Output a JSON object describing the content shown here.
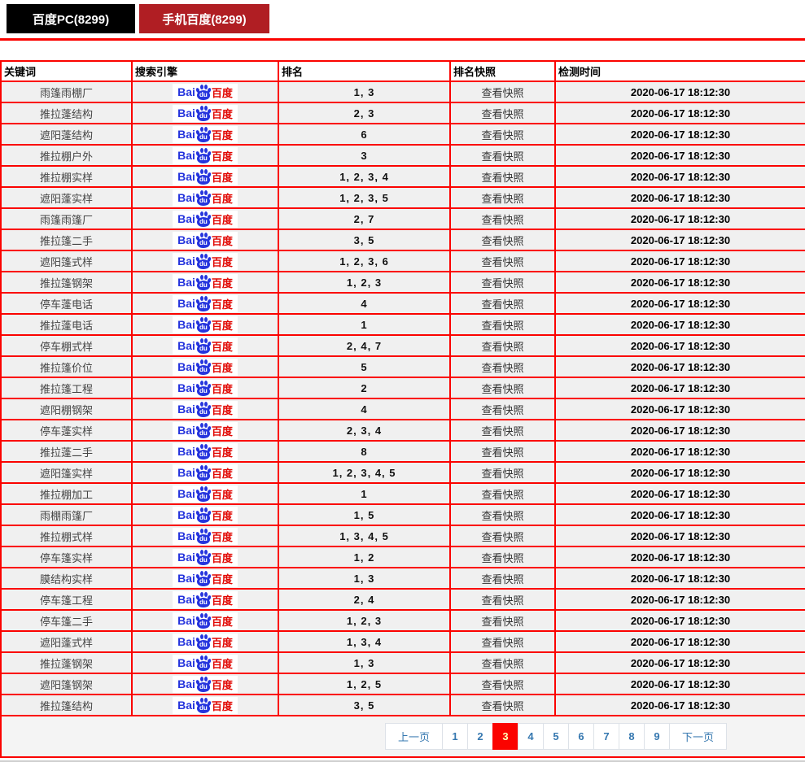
{
  "tabs": [
    {
      "label": "百度PC(8299)"
    },
    {
      "label": "手机百度(8299)"
    }
  ],
  "colors": {
    "tab_pc_bg": "#000000",
    "tab_mobile_bg": "#b01e23",
    "table_border": "#fb0300",
    "row_bg": "#f0f0f0",
    "pager_link": "#3678b0",
    "pager_active_bg": "#fb0300",
    "pager_active_text": "#ffffb8",
    "logo_blue": "#2534dd",
    "logo_red": "#e10601"
  },
  "table": {
    "headers": [
      "关键词",
      "搜索引擎",
      "排名",
      "排名快照",
      "检测时间"
    ],
    "engine_logo": {
      "bai": "Bai",
      "du": "du",
      "cn": "百度",
      "icon": "baidu-paw-icon"
    },
    "rows": [
      {
        "keyword": "雨篷雨棚厂",
        "ranking": "1, 3",
        "snapshot": "查看快照",
        "time": "2020-06-17 18:12:30"
      },
      {
        "keyword": "推拉蓬结构",
        "ranking": "2, 3",
        "snapshot": "查看快照",
        "time": "2020-06-17 18:12:30"
      },
      {
        "keyword": "遮阳蓬结构",
        "ranking": "6",
        "snapshot": "查看快照",
        "time": "2020-06-17 18:12:30"
      },
      {
        "keyword": "推拉棚户外",
        "ranking": "3",
        "snapshot": "查看快照",
        "time": "2020-06-17 18:12:30"
      },
      {
        "keyword": "推拉棚实样",
        "ranking": "1, 2, 3, 4",
        "snapshot": "查看快照",
        "time": "2020-06-17 18:12:30"
      },
      {
        "keyword": "遮阳蓬实样",
        "ranking": "1, 2, 3, 5",
        "snapshot": "查看快照",
        "time": "2020-06-17 18:12:30"
      },
      {
        "keyword": "雨篷雨篷厂",
        "ranking": "2, 7",
        "snapshot": "查看快照",
        "time": "2020-06-17 18:12:30"
      },
      {
        "keyword": "推拉篷二手",
        "ranking": "3, 5",
        "snapshot": "查看快照",
        "time": "2020-06-17 18:12:30"
      },
      {
        "keyword": "遮阳篷式样",
        "ranking": "1, 2, 3, 6",
        "snapshot": "查看快照",
        "time": "2020-06-17 18:12:30"
      },
      {
        "keyword": "推拉篷钢架",
        "ranking": "1, 2, 3",
        "snapshot": "查看快照",
        "time": "2020-06-17 18:12:30"
      },
      {
        "keyword": "停车蓬电话",
        "ranking": "4",
        "snapshot": "查看快照",
        "time": "2020-06-17 18:12:30"
      },
      {
        "keyword": "推拉蓬电话",
        "ranking": "1",
        "snapshot": "查看快照",
        "time": "2020-06-17 18:12:30"
      },
      {
        "keyword": "停车棚式样",
        "ranking": "2, 4, 7",
        "snapshot": "查看快照",
        "time": "2020-06-17 18:12:30"
      },
      {
        "keyword": "推拉篷价位",
        "ranking": "5",
        "snapshot": "查看快照",
        "time": "2020-06-17 18:12:30"
      },
      {
        "keyword": "推拉篷工程",
        "ranking": "2",
        "snapshot": "查看快照",
        "time": "2020-06-17 18:12:30"
      },
      {
        "keyword": "遮阳棚钢架",
        "ranking": "4",
        "snapshot": "查看快照",
        "time": "2020-06-17 18:12:30"
      },
      {
        "keyword": "停车蓬实样",
        "ranking": "2, 3, 4",
        "snapshot": "查看快照",
        "time": "2020-06-17 18:12:30"
      },
      {
        "keyword": "推拉蓬二手",
        "ranking": "8",
        "snapshot": "查看快照",
        "time": "2020-06-17 18:12:30"
      },
      {
        "keyword": "遮阳篷实样",
        "ranking": "1, 2, 3, 4, 5",
        "snapshot": "查看快照",
        "time": "2020-06-17 18:12:30"
      },
      {
        "keyword": "推拉棚加工",
        "ranking": "1",
        "snapshot": "查看快照",
        "time": "2020-06-17 18:12:30"
      },
      {
        "keyword": "雨棚雨篷厂",
        "ranking": "1, 5",
        "snapshot": "查看快照",
        "time": "2020-06-17 18:12:30"
      },
      {
        "keyword": "推拉棚式样",
        "ranking": "1, 3, 4, 5",
        "snapshot": "查看快照",
        "time": "2020-06-17 18:12:30"
      },
      {
        "keyword": "停车篷实样",
        "ranking": "1, 2",
        "snapshot": "查看快照",
        "time": "2020-06-17 18:12:30"
      },
      {
        "keyword": "膜结构实样",
        "ranking": "1, 3",
        "snapshot": "查看快照",
        "time": "2020-06-17 18:12:30"
      },
      {
        "keyword": "停车篷工程",
        "ranking": "2, 4",
        "snapshot": "查看快照",
        "time": "2020-06-17 18:12:30"
      },
      {
        "keyword": "停车篷二手",
        "ranking": "1, 2, 3",
        "snapshot": "查看快照",
        "time": "2020-06-17 18:12:30"
      },
      {
        "keyword": "遮阳蓬式样",
        "ranking": "1, 3, 4",
        "snapshot": "查看快照",
        "time": "2020-06-17 18:12:30"
      },
      {
        "keyword": "推拉蓬钢架",
        "ranking": "1, 3",
        "snapshot": "查看快照",
        "time": "2020-06-17 18:12:30"
      },
      {
        "keyword": "遮阳篷钢架",
        "ranking": "1, 2, 5",
        "snapshot": "查看快照",
        "time": "2020-06-17 18:12:30"
      },
      {
        "keyword": "推拉篷结构",
        "ranking": "3, 5",
        "snapshot": "查看快照",
        "time": "2020-06-17 18:12:30"
      }
    ]
  },
  "pagination": {
    "prev": "上一页",
    "pages": [
      "1",
      "2",
      "3",
      "4",
      "5",
      "6",
      "7",
      "8",
      "9"
    ],
    "active": "3",
    "next": "下一页"
  }
}
